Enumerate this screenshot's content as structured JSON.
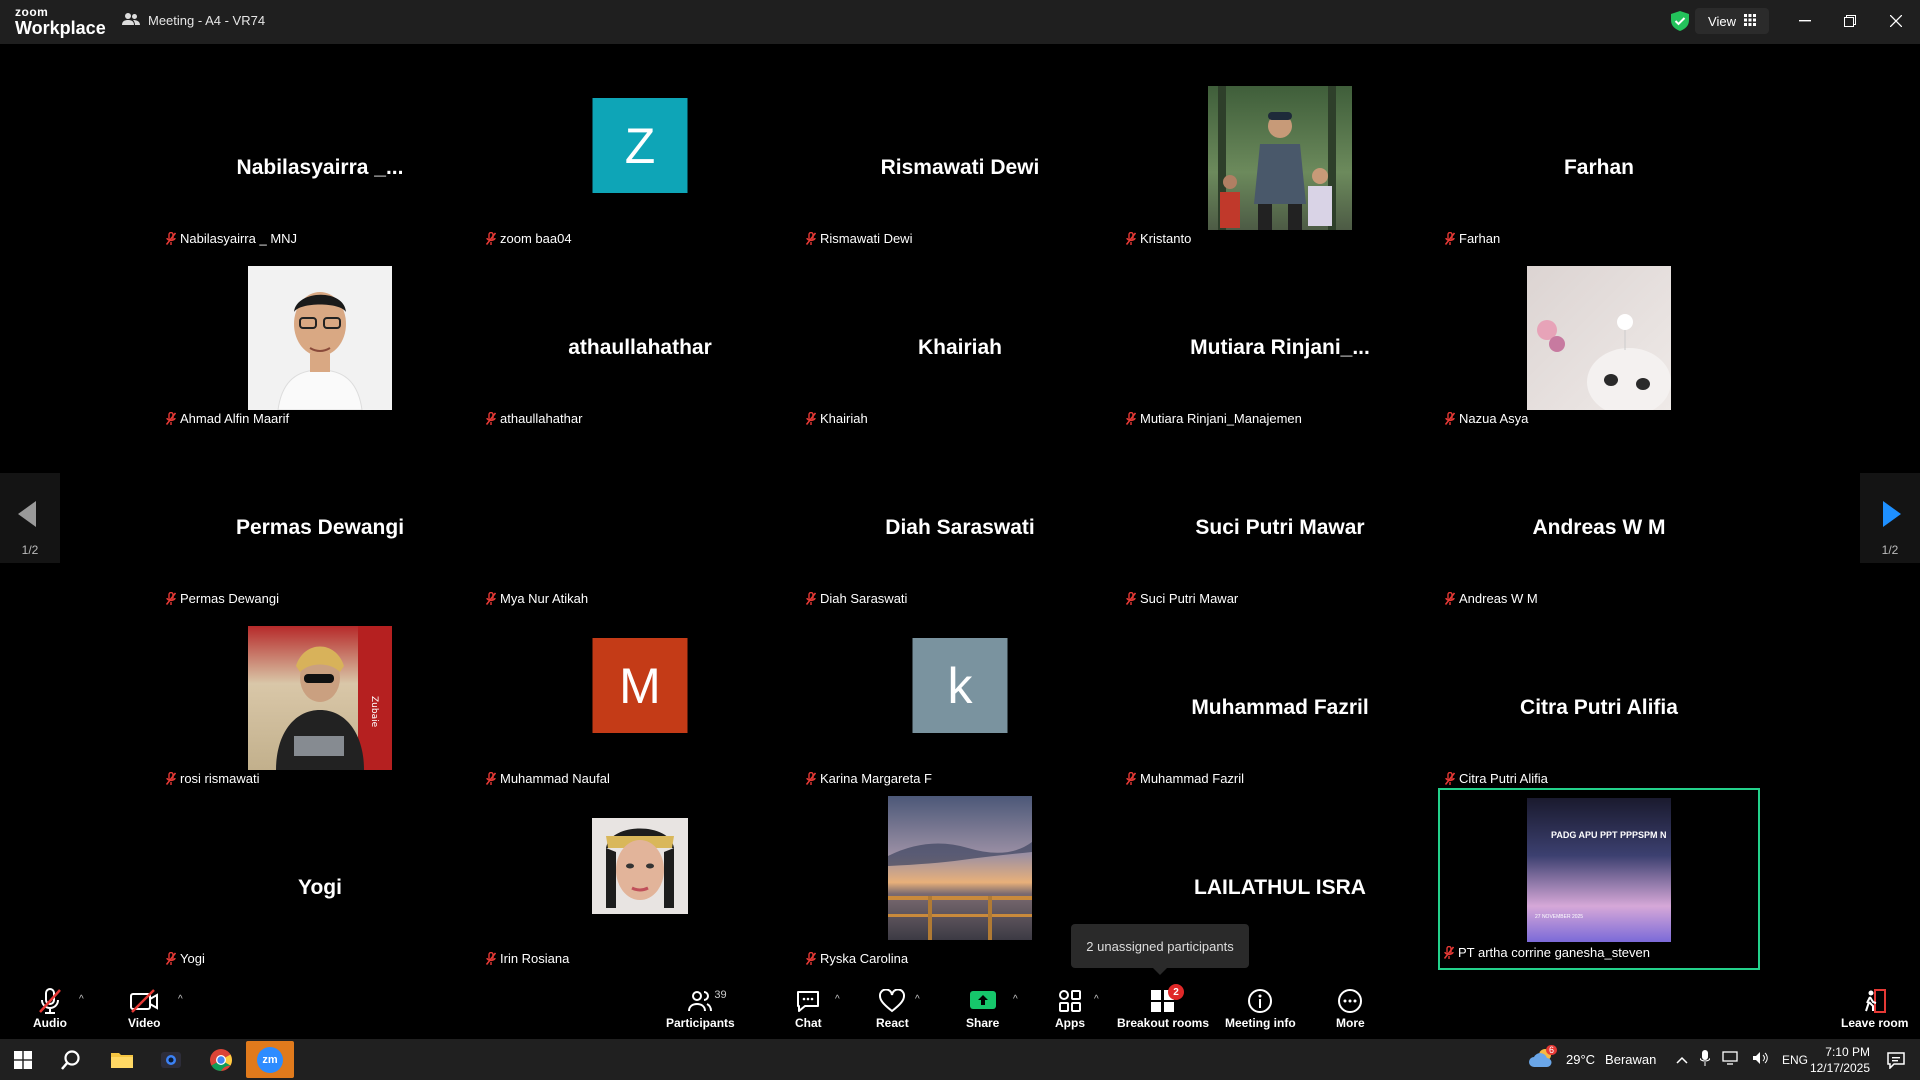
{
  "app": {
    "logo_top": "zoom",
    "logo_bottom": "Workplace",
    "meeting_title": "Meeting - A4 - VR74",
    "view_label": "View"
  },
  "tiles": [
    {
      "big": "Nabilasyairra _...",
      "label": "Nabilasyairra _ MNJ"
    },
    {
      "letter": "Z",
      "color": "#0ea5b7",
      "label": "zoom baa04"
    },
    {
      "big": "Rismawati Dewi",
      "label": "Rismawati Dewi"
    },
    {
      "photo": "runner",
      "label": "Kristanto"
    },
    {
      "big": "Farhan",
      "label": "Farhan"
    },
    {
      "photo": "man-portrait",
      "label": "Ahmad Alfin Maarif"
    },
    {
      "big": "athaullahathar",
      "label": "athaullahathar"
    },
    {
      "big": "Khairiah",
      "label": "Khairiah"
    },
    {
      "big": "Mutiara  Rinjani_...",
      "label": "Mutiara Rinjani_Manajemen"
    },
    {
      "photo": "cat",
      "label": "Nazua Asya"
    },
    {
      "big": "Permas Dewangi",
      "label": "Permas Dewangi"
    },
    {
      "photo": "black",
      "label": "Mya Nur Atikah"
    },
    {
      "big": "Diah Saraswati",
      "label": "Diah Saraswati"
    },
    {
      "big": "Suci Putri Mawar",
      "label": "Suci Putri Mawar"
    },
    {
      "big": "Andreas W M",
      "label": "Andreas W M"
    },
    {
      "photo": "woman-sunglasses",
      "label": "rosi rismawati"
    },
    {
      "letter": "M",
      "color": "#c43b17",
      "label": "Muhammad Naufal"
    },
    {
      "letter": "k",
      "color": "#7a939f",
      "label": "Karina Margareta F"
    },
    {
      "big": "Muhammad Fazril",
      "label": "Muhammad Fazril"
    },
    {
      "big": "Citra Putri Alifia",
      "label": "Citra Putri Alifia"
    },
    {
      "big": "Yogi",
      "label": "Yogi"
    },
    {
      "photo": "woman-face",
      "label": "Irin Rosiana"
    },
    {
      "photo": "sunset",
      "label": "Ryska Carolina"
    },
    {
      "big": "LAILATHUL ISRA",
      "label": "LAILATHUL ISRA",
      "no_label": true
    },
    {
      "photo": "slide",
      "label": "PT artha corrine ganesha_steven",
      "active": true,
      "slide_text": "PADG APU PPT PPPSPM N",
      "slide_date": "27 NOVEMBER 2025"
    }
  ],
  "nav": {
    "left_page": "1/2",
    "right_page": "1/2"
  },
  "tooltip": "2 unassigned participants",
  "toolbar": {
    "audio": "Audio",
    "video": "Video",
    "participants": "Participants",
    "participants_count": "39",
    "chat": "Chat",
    "react": "React",
    "share": "Share",
    "apps": "Apps",
    "breakout": "Breakout rooms",
    "breakout_badge": "2",
    "meeting_info": "Meeting info",
    "more": "More",
    "leave": "Leave room"
  },
  "taskbar": {
    "weather_badge": "6",
    "temperature": "29°C",
    "weather": "Berawan",
    "lang": "ENG",
    "time": "7:10 PM",
    "date": "12/17/2025"
  },
  "colors": {
    "accent_green": "#23d18b",
    "share_green": "#16c66b",
    "mute_red": "#e53935"
  }
}
